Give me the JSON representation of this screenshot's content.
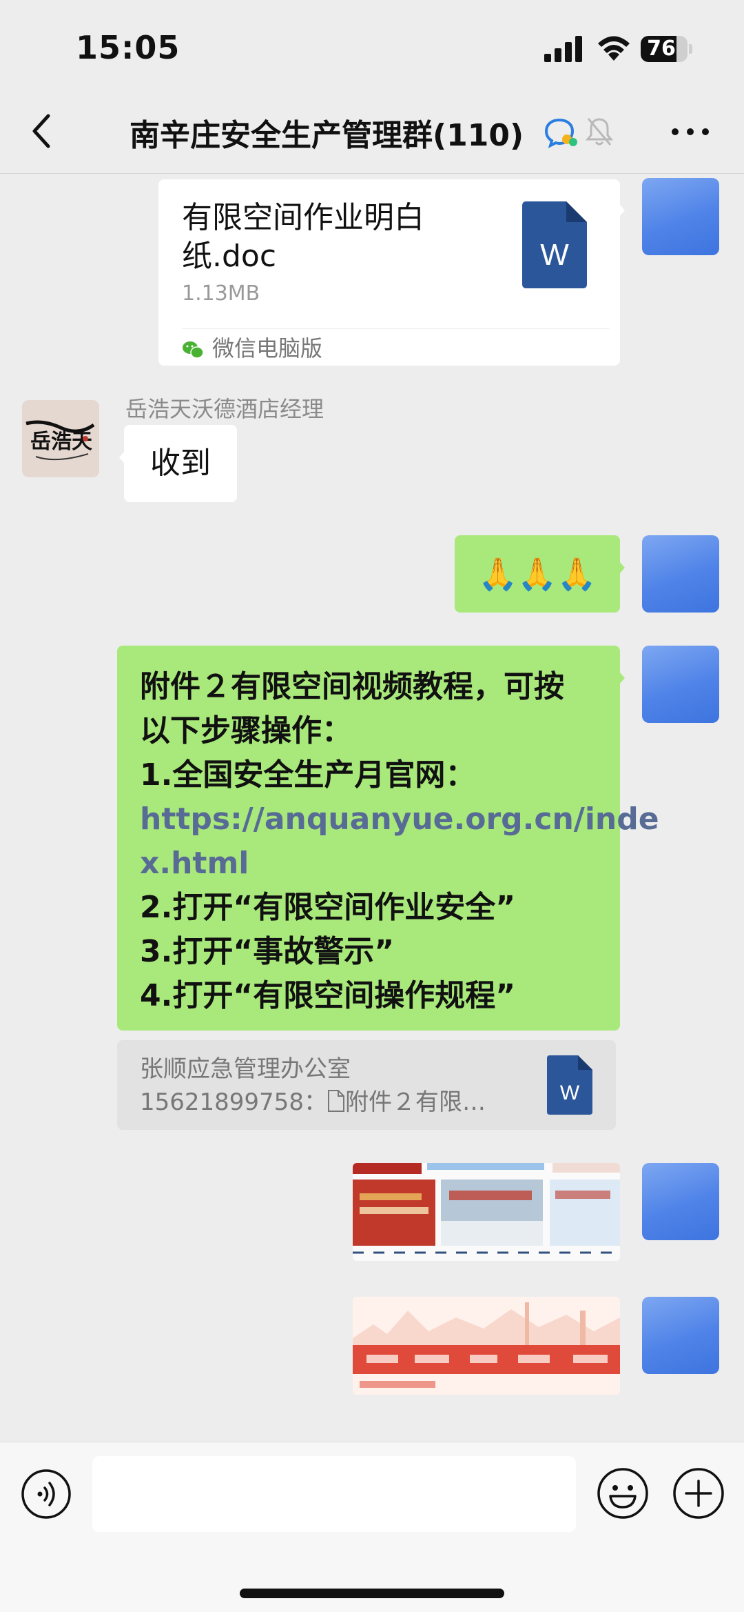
{
  "status_bar": {
    "time": "15:05",
    "battery_level": "76",
    "battery_fraction": 0.76
  },
  "nav": {
    "title": "南辛庄安全生产管理群(110)"
  },
  "messages": {
    "file": {
      "name": "有限空间作业明白纸.doc",
      "size": "1.13MB",
      "source": "微信电脑版"
    },
    "reply": {
      "sender": "岳浩天沃德酒店经理",
      "text": "收到",
      "avatar_text": "岳浩天"
    },
    "emoji": {
      "text": "🙏🙏🙏"
    },
    "instructions": {
      "line1": "附件２有限空间视频教程，可按",
      "line2": "以下步骤操作：",
      "line3": "1.全国安全生产月官网：",
      "link1": "https://anquanyue.org.cn/inde",
      "link2": "x.html",
      "line4": "2.打开“有限空间作业安全”",
      "line5": "3.打开“事故警示”",
      "line6": "4.打开“有限空间操作规程”"
    },
    "quote": {
      "line1": "张顺应急管理办公室",
      "line2_prefix": "15621899758：",
      "line2_suffix": "附件２有限…"
    }
  },
  "icons": {
    "word_letter": "W"
  },
  "colors": {
    "chat_bg": "#ededed",
    "bubble_green": "#a9e97b",
    "link": "#576b95",
    "word_blue": "#2b579a"
  }
}
